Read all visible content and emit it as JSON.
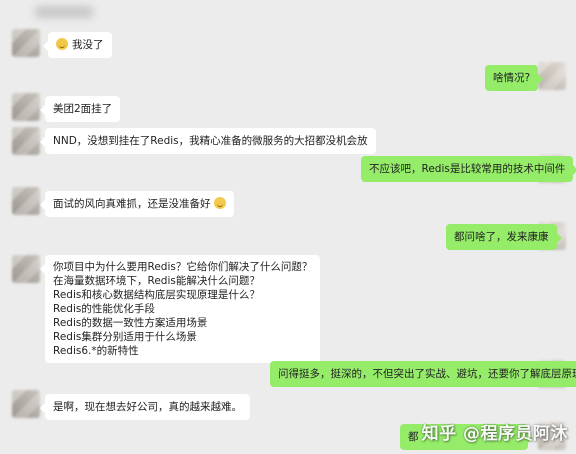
{
  "messages": {
    "m1": "我没了",
    "m2": "啥情况?",
    "m3": "美团2面挂了",
    "m4": "NND，没想到挂在了Redis，我精心准备的微服务的大招都没机会放",
    "m5": "不应该吧，Redis是比较常用的技术中间件",
    "m6": "面试的风向真难抓，还是没准备好",
    "m7": "都问啥了，发来康康",
    "m8": [
      "你项目中为什么要用Redis？它给你们解决了什么问题？",
      "在海量数据环境下，Redis能解决什么问题？",
      "Redis和核心数据结构底层实现原理是什么？",
      "Redis的性能优化手段",
      "Redis的数据一致性方案适用场景",
      "Redis集群分别适用于什么场景",
      "Redis6.*的新特性"
    ],
    "m9": "问得挺多，挺深的，不但突出了实战、避坑，还要你了解底层原理",
    "m10": "是啊，现在想去好公司，真的越来越难。",
    "m11": "都"
  },
  "watermark": "知乎 @程序员阿沐",
  "colors": {
    "background": "#ececec",
    "incoming_bubble": "#ffffff",
    "outgoing_bubble": "#95ec69"
  }
}
